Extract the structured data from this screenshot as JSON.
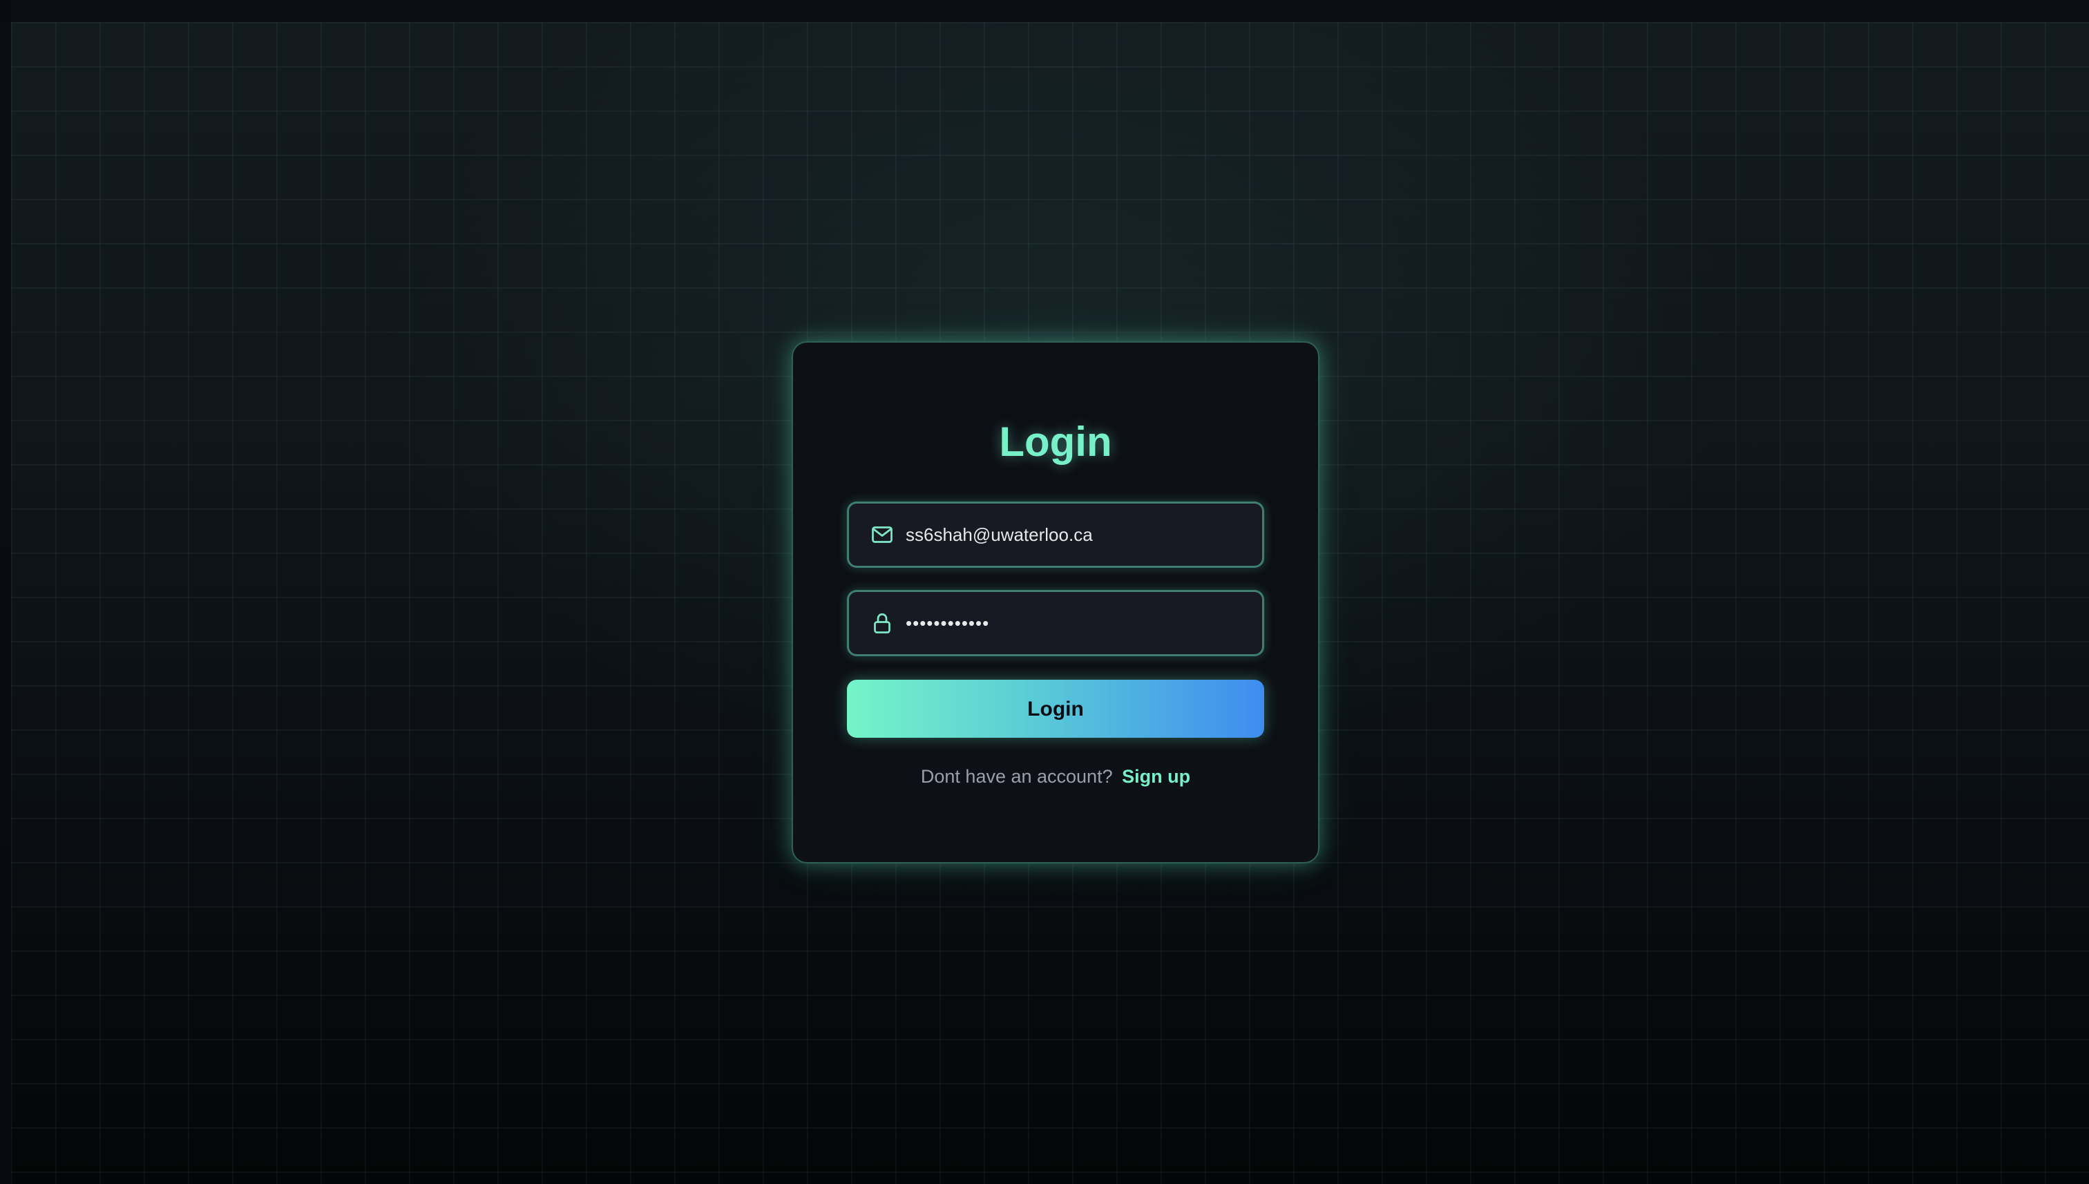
{
  "login_card": {
    "title": "Login",
    "email": {
      "value": "ss6shah@uwaterloo.ca",
      "icon": "mail-icon"
    },
    "password": {
      "value": "••••••••••••",
      "icon": "lock-icon"
    },
    "submit_label": "Login",
    "signup_prompt": "Dont have an account?",
    "signup_link": "Sign up"
  },
  "colors": {
    "accent": "#78f0c8",
    "gradient_start": "#74f4c8",
    "gradient_end": "#3f8cf0",
    "card_background": "#0d1016",
    "page_background": "#0a0e12"
  }
}
